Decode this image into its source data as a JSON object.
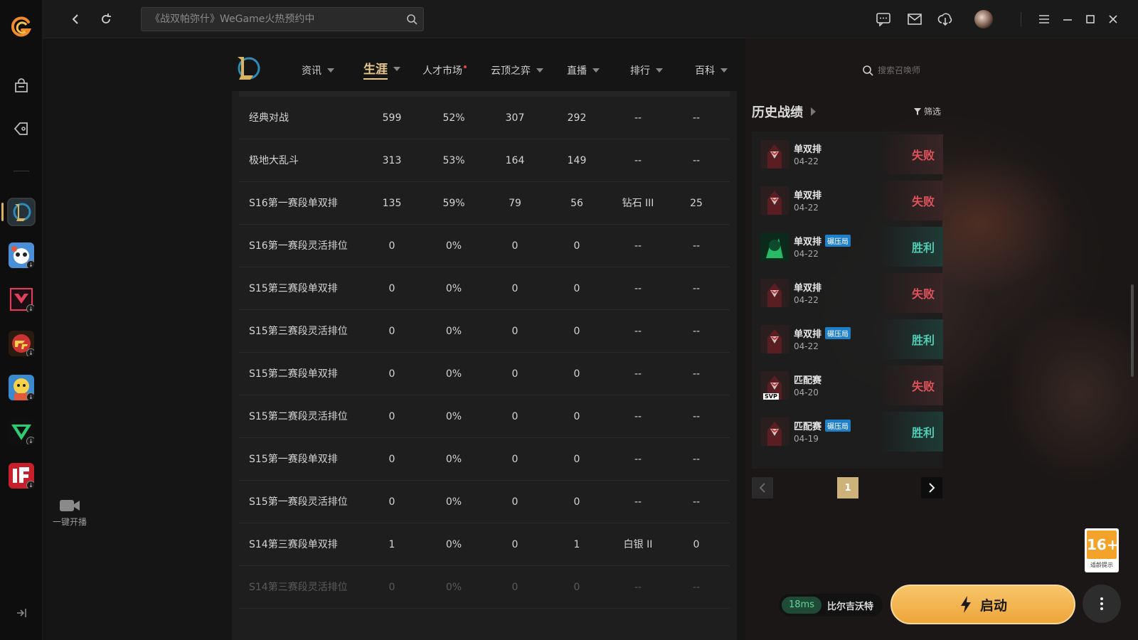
{
  "topbar": {
    "search_placeholder": "《战双帕弥什》WeGame火热预约中"
  },
  "rail": {
    "live_label": "一键开播"
  },
  "game_nav": {
    "items": [
      {
        "label": "资讯"
      },
      {
        "label": "生涯"
      },
      {
        "label": "人才市场"
      },
      {
        "label": "云顶之弈"
      },
      {
        "label": "直播"
      },
      {
        "label": "排行"
      },
      {
        "label": "百科"
      }
    ],
    "summoner_search_placeholder": "搜索召唤师"
  },
  "stats_table": {
    "rows": [
      [
        "经典对战",
        "599",
        "52%",
        "307",
        "292",
        "--",
        "--"
      ],
      [
        "极地大乱斗",
        "313",
        "53%",
        "164",
        "149",
        "--",
        "--"
      ],
      [
        "S16第一赛段单双排",
        "135",
        "59%",
        "79",
        "56",
        "钻石 III",
        "25"
      ],
      [
        "S16第一赛段灵活排位",
        "0",
        "0%",
        "0",
        "0",
        "--",
        "--"
      ],
      [
        "S15第三赛段单双排",
        "0",
        "0%",
        "0",
        "0",
        "--",
        "--"
      ],
      [
        "S15第三赛段灵活排位",
        "0",
        "0%",
        "0",
        "0",
        "--",
        "--"
      ],
      [
        "S15第二赛段单双排",
        "0",
        "0%",
        "0",
        "0",
        "--",
        "--"
      ],
      [
        "S15第二赛段灵活排位",
        "0",
        "0%",
        "0",
        "0",
        "--",
        "--"
      ],
      [
        "S15第一赛段单双排",
        "0",
        "0%",
        "0",
        "0",
        "--",
        "--"
      ],
      [
        "S15第一赛段灵活排位",
        "0",
        "0%",
        "0",
        "0",
        "--",
        "--"
      ],
      [
        "S14第三赛段单双排",
        "1",
        "0%",
        "0",
        "1",
        "白银 II",
        "0"
      ],
      [
        "S14第三赛段灵活排位",
        "0",
        "0%",
        "0",
        "0",
        "--",
        "--"
      ]
    ]
  },
  "history": {
    "title": "历史战绩",
    "filter_label": "筛选",
    "matches": [
      {
        "mode": "单双排",
        "tag": "",
        "date": "04-22",
        "result": "失败",
        "outcome": "loss",
        "svp": ""
      },
      {
        "mode": "单双排",
        "tag": "",
        "date": "04-22",
        "result": "失败",
        "outcome": "loss",
        "svp": ""
      },
      {
        "mode": "单双排",
        "tag": "碾压局",
        "date": "04-22",
        "result": "胜利",
        "outcome": "win",
        "svp": ""
      },
      {
        "mode": "单双排",
        "tag": "",
        "date": "04-22",
        "result": "失败",
        "outcome": "loss",
        "svp": ""
      },
      {
        "mode": "单双排",
        "tag": "碾压局",
        "date": "04-22",
        "result": "胜利",
        "outcome": "win",
        "svp": ""
      },
      {
        "mode": "匹配赛",
        "tag": "",
        "date": "04-20",
        "result": "失败",
        "outcome": "loss",
        "svp": "SVP"
      },
      {
        "mode": "匹配赛",
        "tag": "碾压局",
        "date": "04-19",
        "result": "胜利",
        "outcome": "win",
        "svp": ""
      }
    ],
    "current_page": "1"
  },
  "age_rating": {
    "value": "16+",
    "label": "适龄提示"
  },
  "launch_bar": {
    "ping": "18ms",
    "server": "比尔吉沃特",
    "launch_label": "启动"
  },
  "colors": {
    "accent_gold": "#e6c98a",
    "win": "#4ecdb4",
    "loss": "#e0525a",
    "launch": "#f3b150"
  }
}
